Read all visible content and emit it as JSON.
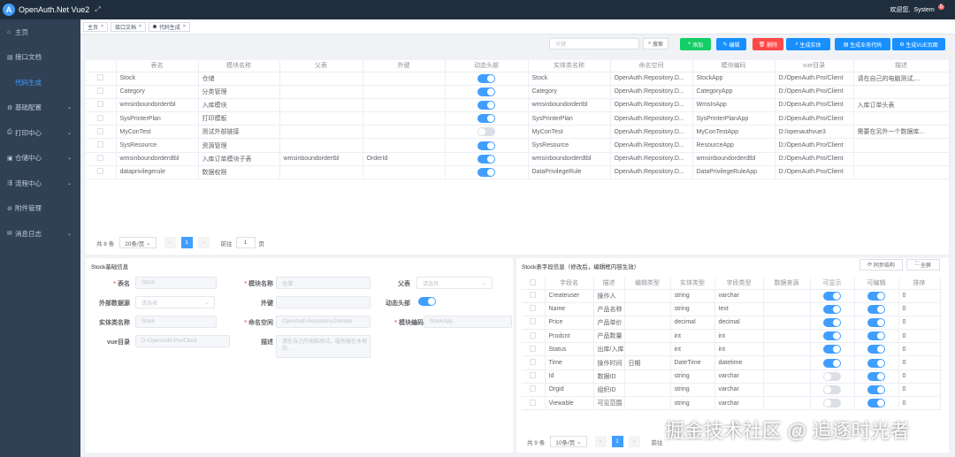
{
  "header": {
    "brand": "OpenAuth.Net Vue2",
    "welcome": "欢迎您,",
    "user": "System",
    "badge": "5",
    "colors": {
      "bg": "#1f2d3d",
      "accent": "#409eff"
    }
  },
  "sidebar": {
    "items": [
      {
        "label": "主页",
        "icon": "home-icon",
        "chev": false,
        "active": false
      },
      {
        "label": "接口文档",
        "icon": "doc-icon",
        "chev": false,
        "active": false
      },
      {
        "label": "代码生成",
        "icon": "code-icon",
        "chev": false,
        "active": true
      },
      {
        "label": "基础配置",
        "icon": "gear-icon",
        "chev": true,
        "active": false
      },
      {
        "label": "打印中心",
        "icon": "print-icon",
        "chev": true,
        "active": false
      },
      {
        "label": "仓储中心",
        "icon": "box-icon",
        "chev": true,
        "active": false
      },
      {
        "label": "流程中心",
        "icon": "flow-icon",
        "chev": true,
        "active": false
      },
      {
        "label": "附件管理",
        "icon": "attach-icon",
        "chev": false,
        "active": false
      },
      {
        "label": "消息日志",
        "icon": "message-icon",
        "chev": true,
        "active": false
      }
    ]
  },
  "tags": [
    {
      "label": "主页"
    },
    {
      "label": "接口文档"
    },
    {
      "label": "代码生成"
    }
  ],
  "toolbar": {
    "keyword_placeholder": "关键",
    "search_label": "搜索",
    "buttons": [
      {
        "label": "添加",
        "color": "#13ce66",
        "icon": "plus-icon"
      },
      {
        "label": "编辑",
        "color": "#1890ff",
        "icon": "edit-icon"
      },
      {
        "label": "删除",
        "color": "#ff4949",
        "icon": "trash-icon"
      },
      {
        "label": "生成实体",
        "color": "#1890ff",
        "icon": "search-icon"
      },
      {
        "label": "生成业务代码",
        "color": "#1890ff",
        "icon": "doc-icon"
      },
      {
        "label": "生成VUE页面",
        "color": "#1890ff",
        "icon": "gear-icon"
      }
    ]
  },
  "main_table": {
    "headers": [
      "表名",
      "模块名称",
      "父表",
      "外键",
      "动态头部",
      "实体类名称",
      "命名空间",
      "模块编码",
      "vue目录",
      "描述"
    ],
    "rows": [
      [
        "Stock",
        "仓储",
        "",
        "",
        true,
        "Stock",
        "OpenAuth.Repository.D...",
        "StockApp",
        "D:/OpenAuth.Pro/Client",
        "请在自己的电脑测试,..."
      ],
      [
        "Category",
        "分类管理",
        "",
        "",
        true,
        "Category",
        "OpenAuth.Repository.D...",
        "CategoryApp",
        "D:/OpenAuth.Pro/Client",
        ""
      ],
      [
        "wmsinboundordertbl",
        "入库模块",
        "",
        "",
        true,
        "wmsinboundordertbl",
        "OpenAuth.Repository.D...",
        "WmsInApp",
        "D:/OpenAuth.Pro/Client",
        "入库订单头表"
      ],
      [
        "SysPrinterPlan",
        "打印模板",
        "",
        "",
        true,
        "SysPrinterPlan",
        "OpenAuth.Repository.D...",
        "SysPrinterPlanApp",
        "D:/OpenAuth.Pro/Client",
        ""
      ],
      [
        "MyConTest",
        "测试外部链接",
        "",
        "",
        false,
        "MyConTest",
        "OpenAuth.Repository.D...",
        "MyConTestApp",
        "D:/openauthvue3",
        "需要在另外一个数据库..."
      ],
      [
        "SysResource",
        "资源管理",
        "",
        "",
        true,
        "SysResource",
        "OpenAuth.Repository.D...",
        "ResourceApp",
        "D:/OpenAuth.Pro/Client",
        ""
      ],
      [
        "wmsinboundorderdtbl",
        "入库订单模块子表",
        "wmsinboundordertbl",
        "OrderId",
        true,
        "wmsinboundorderdtbl",
        "OpenAuth.Repository.D...",
        "wmsinboundorderdtbl",
        "D:/OpenAuth.Pro/Client",
        ""
      ],
      [
        "dataprivilegerule",
        "数据权限",
        "",
        "",
        true,
        "DataPrivilegeRule",
        "OpenAuth.Repository.D...",
        "DataPrivilegeRuleApp",
        "D:/OpenAuth.Pro/Client",
        ""
      ]
    ],
    "pager": {
      "total": "共 8 条",
      "size": "20条/页",
      "page": "1",
      "goto": "前往",
      "goto_value": "1",
      "unit": "页"
    }
  },
  "form": {
    "title": "Stock基础信息",
    "table_name_label": "表名",
    "table_name_placeholder": "Stock",
    "module_name_label": "模块名称",
    "module_name_placeholder": "仓储",
    "parent_label": "父表",
    "parent_placeholder": "请选择",
    "ext_source_label": "外部数据源",
    "ext_source_placeholder": "请选择",
    "fk_label": "外键",
    "dyn_header_label": "动态头部",
    "entity_label": "实体类名称",
    "entity_placeholder": "Stock",
    "namespace_label": "命名空间",
    "namespace_placeholder": "OpenAuth.Repository.Domain",
    "module_code_label": "模块编码",
    "module_code_placeholder": "StockApp",
    "vue_dir_label": "vue目录",
    "vue_dir_placeholder": "D:/OpenAuth.Pro/Client",
    "desc_label": "描述",
    "desc_placeholder": "请在自己的电脑测试，服务器在本地的..."
  },
  "fields": {
    "title": "Stock表字段信息（修改后，编辑框内容生效）",
    "sync_label": "同步结构",
    "fullscreen_label": "全屏",
    "headers": [
      "字段名",
      "描述",
      "编辑类型",
      "实体类型",
      "字段类型",
      "数据来源",
      "可显示",
      "可编辑",
      "排序"
    ],
    "rows": [
      [
        "Createuser",
        "操作人",
        "",
        "string",
        "varchar",
        "",
        true,
        true,
        "0"
      ],
      [
        "Name",
        "产品名称",
        "",
        "string",
        "text",
        "",
        true,
        true,
        "0"
      ],
      [
        "Price",
        "产品单价",
        "",
        "decimal",
        "decimal",
        "",
        true,
        true,
        "0"
      ],
      [
        "Prodcnt",
        "产品数量",
        "",
        "int",
        "int",
        "",
        true,
        true,
        "0"
      ],
      [
        "Status",
        "出库/入库",
        "",
        "int",
        "int",
        "",
        true,
        true,
        "0"
      ],
      [
        "Time",
        "操作时间",
        "日期",
        "DateTime",
        "datetime",
        "",
        true,
        true,
        "0"
      ],
      [
        "Id",
        "数据ID",
        "",
        "string",
        "varchar",
        "",
        false,
        true,
        "0"
      ],
      [
        "Orgid",
        "组织ID",
        "",
        "string",
        "varchar",
        "",
        false,
        true,
        "0"
      ],
      [
        "Viewable",
        "可见范围",
        "",
        "string",
        "varchar",
        "",
        false,
        true,
        "0"
      ]
    ],
    "pager": {
      "total": "共 9 条",
      "size": "10条/页",
      "page": "1",
      "goto": "前往"
    }
  },
  "watermark": "掘金技术社区 @ 追逐时光者"
}
